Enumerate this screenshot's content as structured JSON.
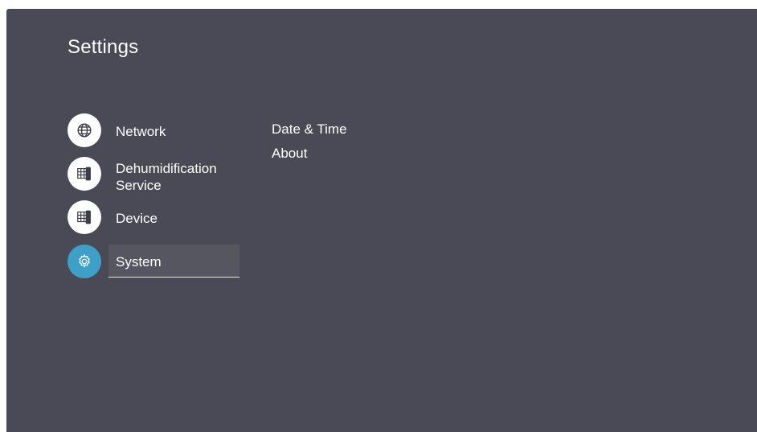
{
  "header": {
    "title": "Settings"
  },
  "menu": {
    "items": [
      {
        "label": "Network",
        "icon": "globe-icon"
      },
      {
        "label_line1": "Dehumidification",
        "label_line2": "Service",
        "icon": "display-device-icon"
      },
      {
        "label": "Device",
        "icon": "display-device-icon"
      },
      {
        "label": "System",
        "icon": "gear-icon",
        "selected": true
      }
    ]
  },
  "submenu": {
    "items": [
      {
        "label": "Date & Time"
      },
      {
        "label": "About"
      }
    ]
  },
  "colors": {
    "panel_bg": "#494a56",
    "accent": "#3ea0c6",
    "text": "#ffffff",
    "selected_bg": "#55565f"
  }
}
